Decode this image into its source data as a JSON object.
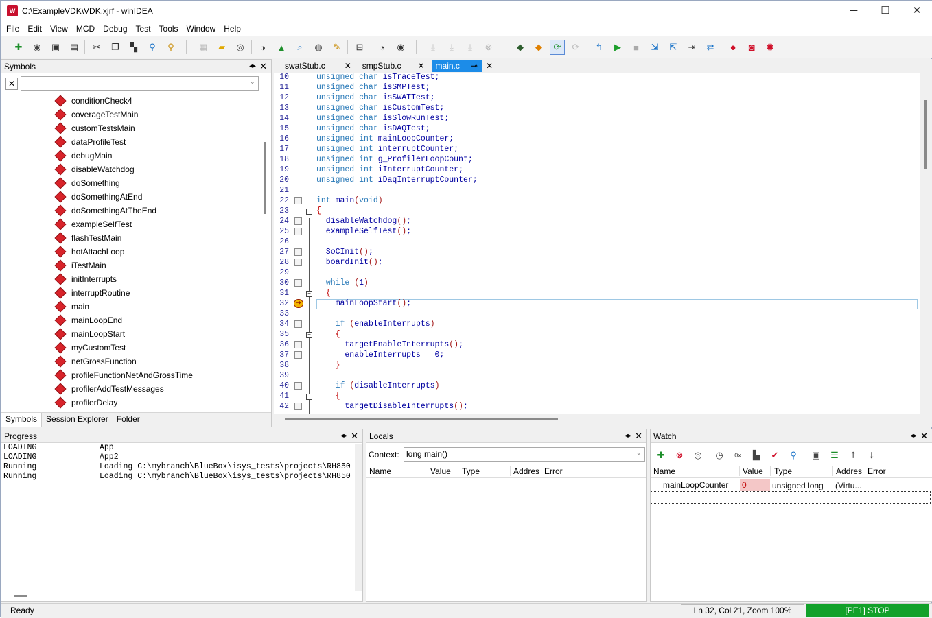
{
  "window": {
    "title": "C:\\ExampleVDK\\VDK.xjrf - winIDEA",
    "app_icon": "winidea-icon",
    "minimize": "─",
    "maximize": "☐",
    "close": "✕"
  },
  "menu": [
    "File",
    "Edit",
    "View",
    "MCD",
    "Debug",
    "Test",
    "Tools",
    "Window",
    "Help"
  ],
  "symbols": {
    "title": "Symbols",
    "filter_value": "",
    "items": [
      "conditionCheck4",
      "coverageTestMain",
      "customTestsMain",
      "dataProfileTest",
      "debugMain",
      "disableWatchdog",
      "doSomething",
      "doSomethingAtEnd",
      "doSomethingAtTheEnd",
      "exampleSelfTest",
      "flashTestMain",
      "hotAttachLoop",
      "iTestMain",
      "initInterrupts",
      "interruptRoutine",
      "main",
      "mainLoopEnd",
      "mainLoopStart",
      "myCustomTest",
      "netGrossFunction",
      "profileFunctionNetAndGrossTime",
      "profilerAddTestMessages",
      "profilerDelay"
    ],
    "bottom_tabs": [
      "Symbols",
      "Session Explorer",
      "Folder"
    ]
  },
  "editor": {
    "tabs": [
      "swatStub.c",
      "smpStub.c",
      "main.c"
    ],
    "active_tab": "main.c",
    "lines": [
      {
        "n": "10",
        "text": "unsigned char isTraceTest;"
      },
      {
        "n": "11",
        "text": "unsigned char isSMPTest;"
      },
      {
        "n": "12",
        "text": "unsigned char isSWATTest;"
      },
      {
        "n": "13",
        "text": "unsigned char isCustomTest;"
      },
      {
        "n": "14",
        "text": "unsigned char isSlowRunTest;"
      },
      {
        "n": "15",
        "text": "unsigned char isDAQTest;"
      },
      {
        "n": "16",
        "text": "unsigned int mainLoopCounter;"
      },
      {
        "n": "17",
        "text": "unsigned int interruptCounter;"
      },
      {
        "n": "18",
        "text": "unsigned int g_ProfilerLoopCount;"
      },
      {
        "n": "19",
        "text": "unsigned int iInterruptCounter;"
      },
      {
        "n": "20",
        "text": "unsigned int iDaqInterruptCounter;"
      },
      {
        "n": "21",
        "text": ""
      },
      {
        "n": "22",
        "text": "int main(void)"
      },
      {
        "n": "23",
        "text": "{"
      },
      {
        "n": "24",
        "text": "  disableWatchdog();"
      },
      {
        "n": "25",
        "text": "  exampleSelfTest();"
      },
      {
        "n": "26",
        "text": ""
      },
      {
        "n": "27",
        "text": "  SoCInit();"
      },
      {
        "n": "28",
        "text": "  boardInit();"
      },
      {
        "n": "29",
        "text": ""
      },
      {
        "n": "30",
        "text": "  while (1)"
      },
      {
        "n": "31",
        "text": "  {"
      },
      {
        "n": "32",
        "text": "    mainLoopStart();"
      },
      {
        "n": "33",
        "text": ""
      },
      {
        "n": "34",
        "text": "    if (enableInterrupts)"
      },
      {
        "n": "35",
        "text": "    {"
      },
      {
        "n": "36",
        "text": "      targetEnableInterrupts();"
      },
      {
        "n": "37",
        "text": "      enableInterrupts = 0;"
      },
      {
        "n": "38",
        "text": "    }"
      },
      {
        "n": "39",
        "text": ""
      },
      {
        "n": "40",
        "text": "    if (disableInterrupts)"
      },
      {
        "n": "41",
        "text": "    {"
      },
      {
        "n": "42",
        "text": "      targetDisableInterrupts();"
      }
    ]
  },
  "progress": {
    "title": "Progress",
    "rows": [
      {
        "status": "LOADING",
        "msg": "App"
      },
      {
        "status": "LOADING",
        "msg": "App2"
      },
      {
        "status": "Running",
        "msg": "Loading C:\\mybranch\\BlueBox\\isys_tests\\projects\\RH850"
      },
      {
        "status": "Running",
        "msg": "Loading C:\\mybranch\\BlueBox\\isys_tests\\projects\\RH850"
      }
    ]
  },
  "locals": {
    "title": "Locals",
    "context_label": "Context:",
    "context_value": "long main()",
    "columns": [
      "Name",
      "Value",
      "Type",
      "Addres",
      "Error"
    ]
  },
  "watch": {
    "title": "Watch",
    "columns": [
      "Name",
      "Value",
      "Type",
      "Addres",
      "Error"
    ],
    "rows": [
      {
        "name": "mainLoopCounter",
        "value": "0",
        "type": "unsigned long",
        "address": "(Virtu..."
      }
    ]
  },
  "status": {
    "left": "Ready",
    "position": "Ln 32, Col 21, Zoom 100%",
    "state": "[PE1] STOP",
    "state_color": "#12a12a"
  }
}
